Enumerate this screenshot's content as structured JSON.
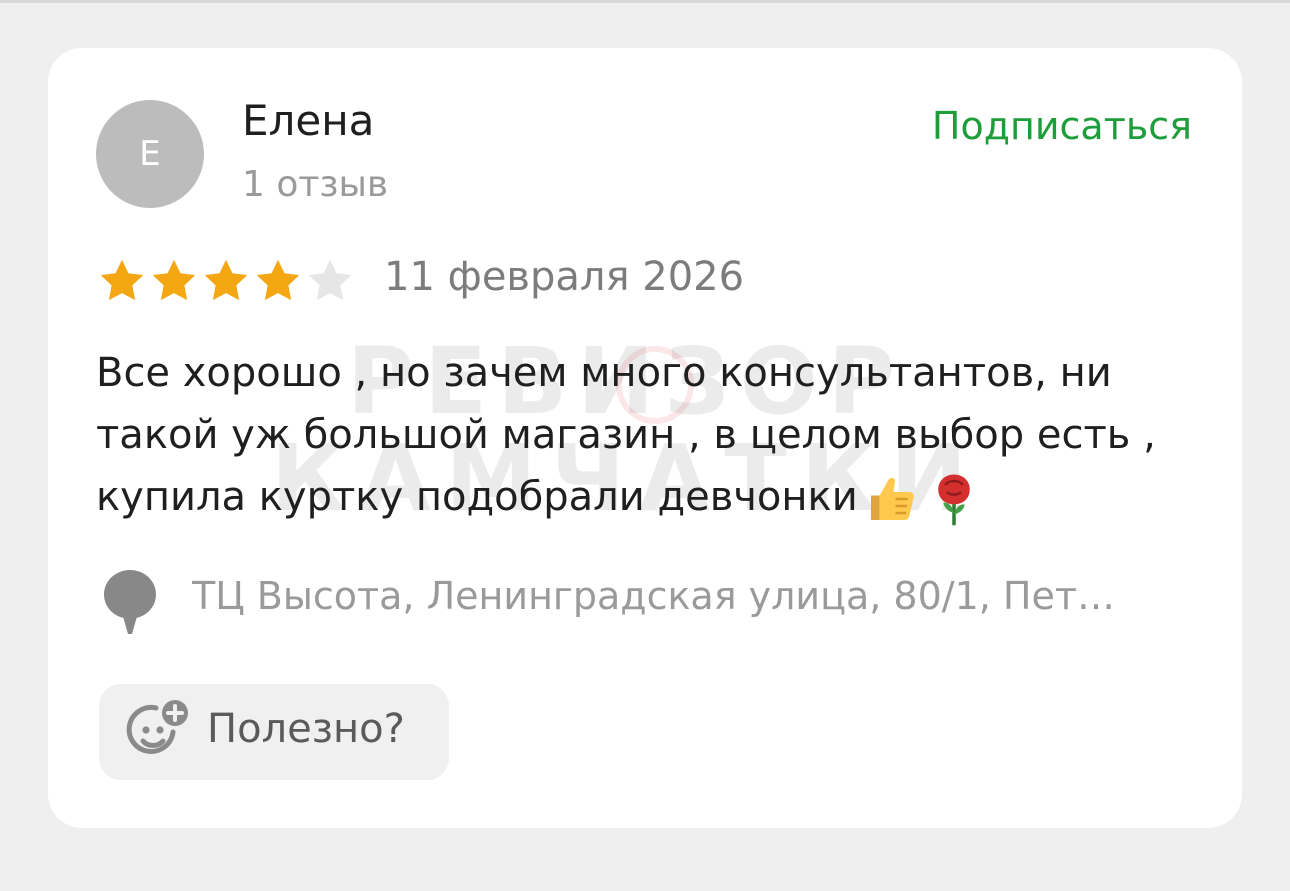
{
  "review": {
    "avatar_letter": "Е",
    "user_name": "Елена",
    "review_count": "1 отзыв",
    "subscribe_label": "Подписаться",
    "rating": 4,
    "max_rating": 5,
    "date": "11 февраля 2026",
    "text": "Все хорошо , но зачем много консультантов, ни такой уж большой магазин , в целом выбор есть , купила куртку подобрали девчонки",
    "emojis": [
      "thumbs-up-icon",
      "rose-icon"
    ],
    "location": "ТЦ Высота, Ленинградская улица, 80/1, Пет…",
    "helpful_label": "Полезно?"
  },
  "watermark": {
    "line1": "РЕВИЗОР",
    "line2": "КАМЧАТКИ"
  },
  "colors": {
    "background": "#efefef",
    "card": "#ffffff",
    "accent_green": "#1e9e3a",
    "star_filled": "#f4a713",
    "star_empty": "#e6e6e6",
    "muted_text": "#9a9a9a"
  }
}
